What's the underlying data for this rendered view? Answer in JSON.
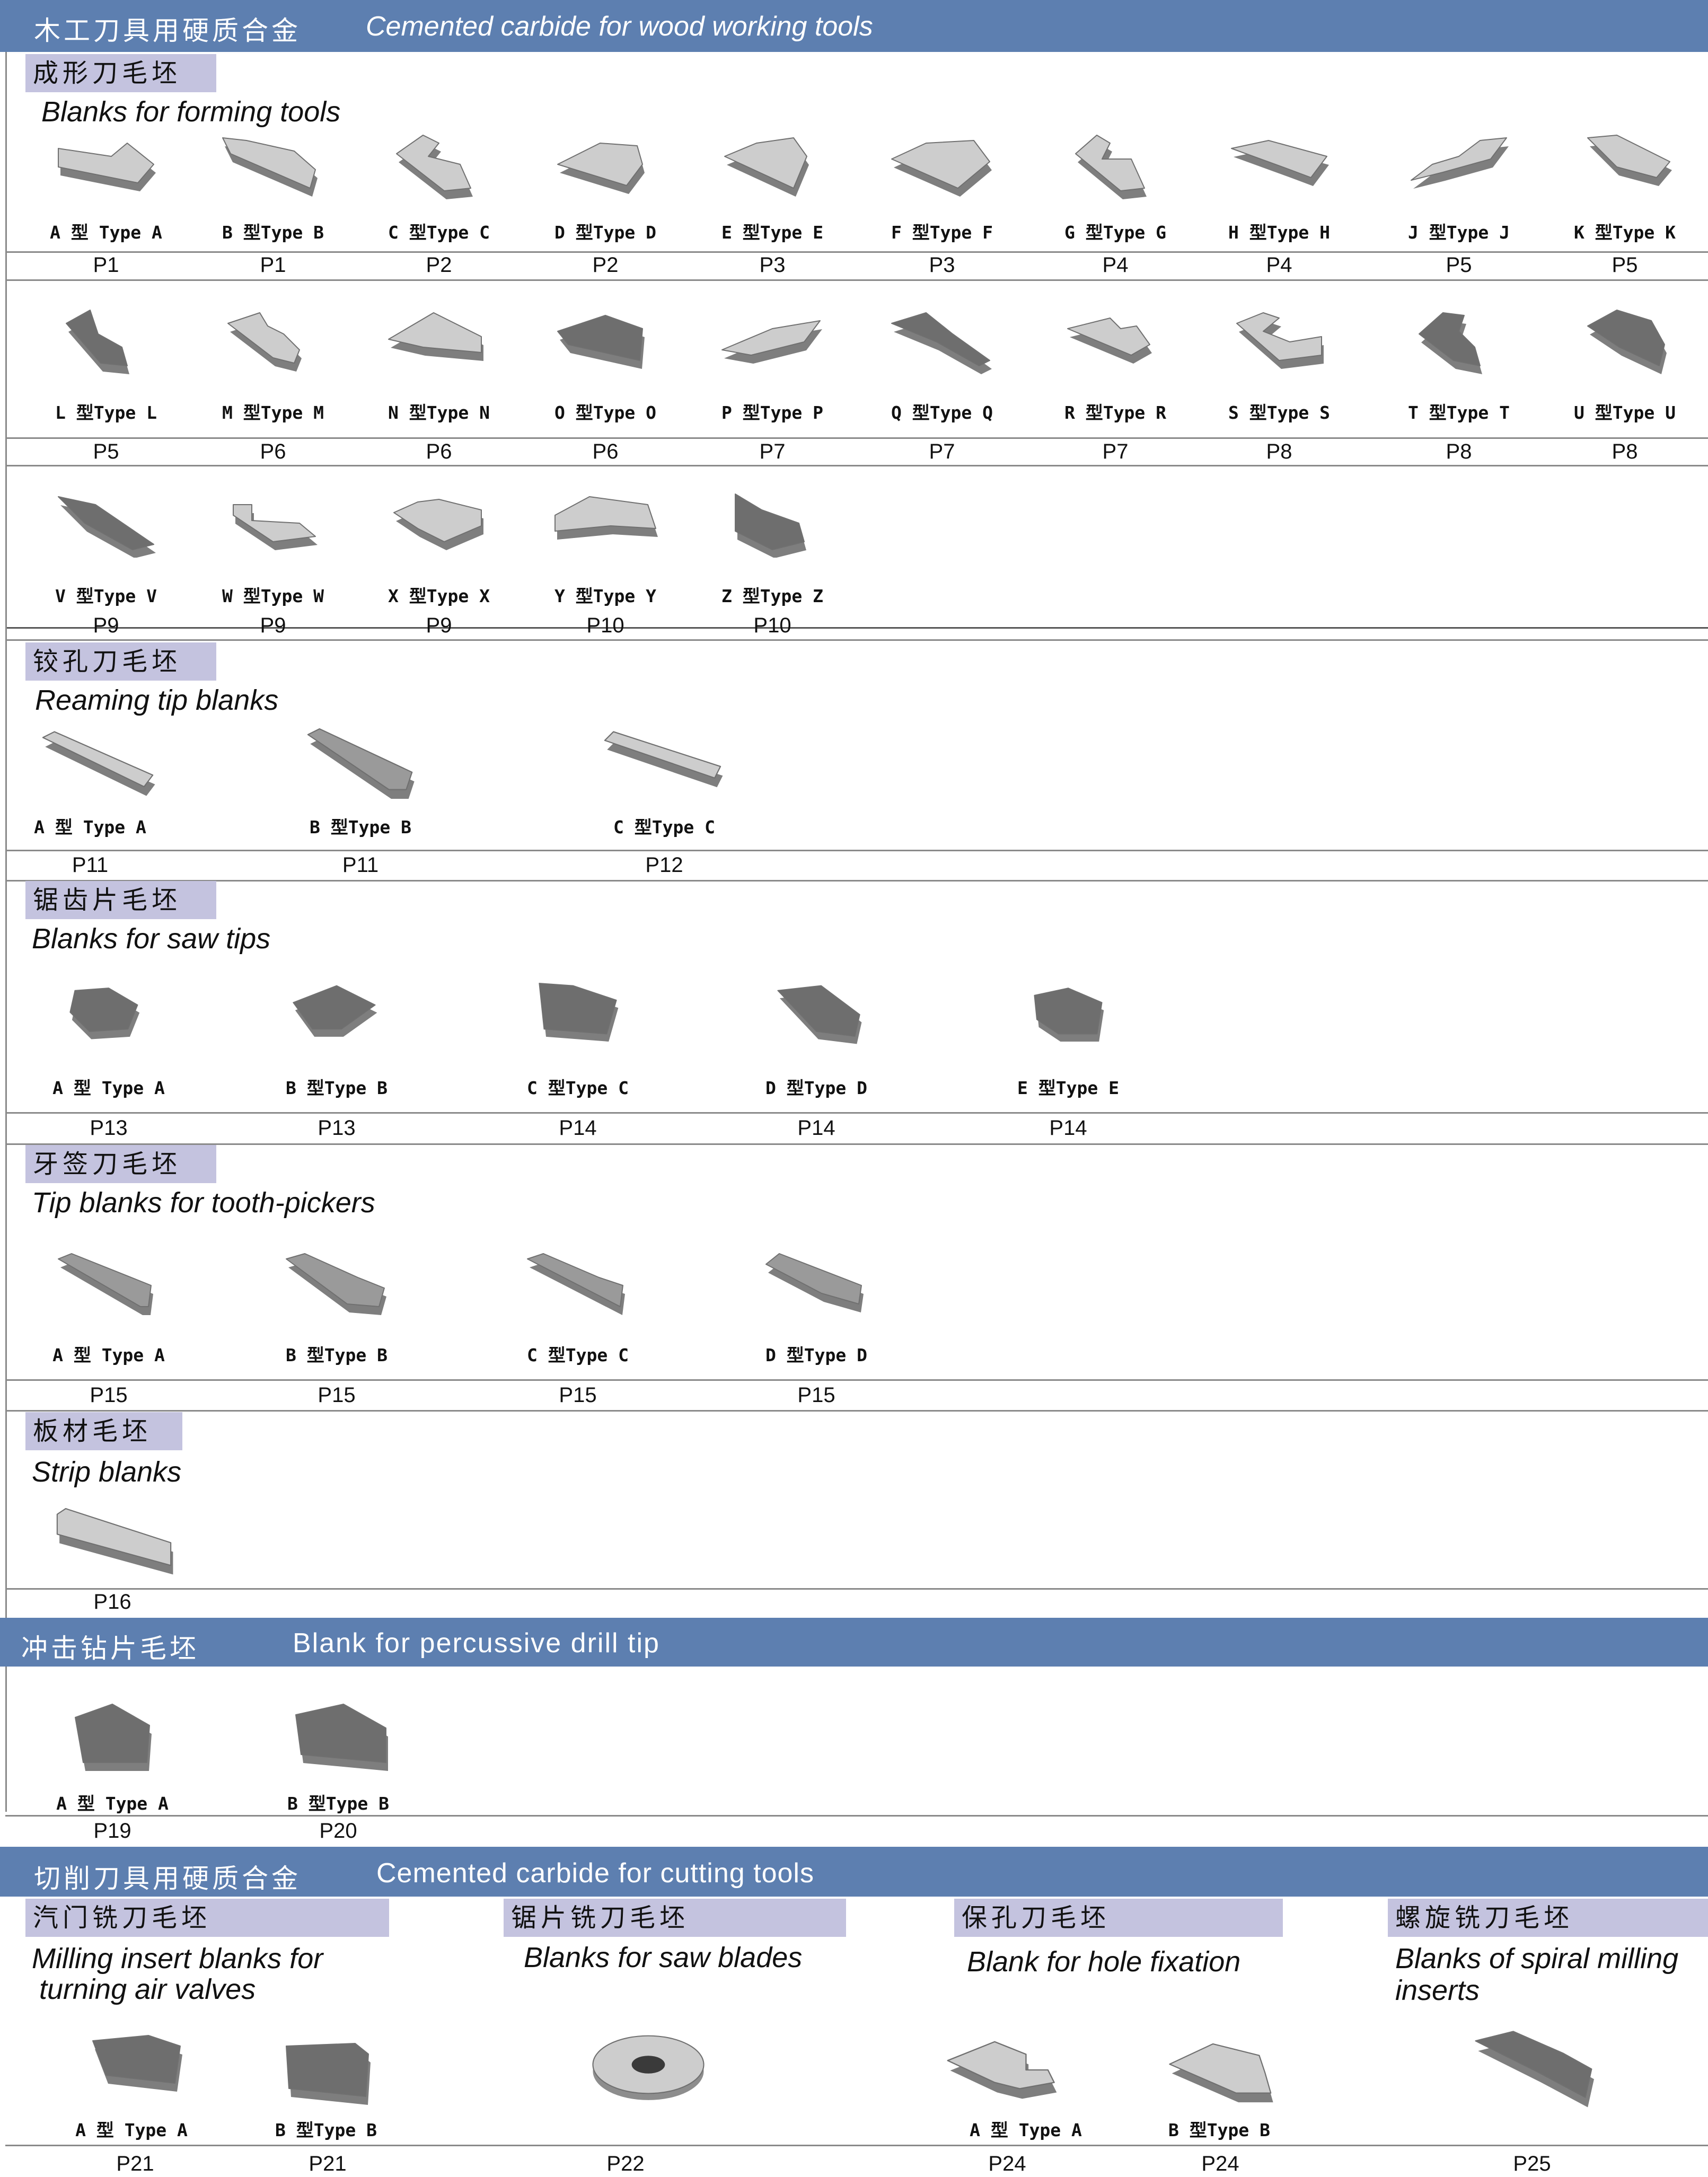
{
  "banner_wood": {
    "cn": "木工刀具用硬质合金",
    "en": "Cemented carbide for wood working tools"
  },
  "forming": {
    "cn": "成形刀毛坯",
    "en": "Blanks  for forming tools",
    "items": [
      {
        "label": "A 型 Type A",
        "page": "P1",
        "shape": "A"
      },
      {
        "label": "B 型Type B",
        "page": "P1",
        "shape": "B"
      },
      {
        "label": "C 型Type C",
        "page": "P2",
        "shape": "C"
      },
      {
        "label": "D 型Type D",
        "page": "P2",
        "shape": "D"
      },
      {
        "label": "E 型Type E",
        "page": "P3",
        "shape": "E"
      },
      {
        "label": "F 型Type F",
        "page": "P3",
        "shape": "F"
      },
      {
        "label": "G 型Type G",
        "page": "P4",
        "shape": "G"
      },
      {
        "label": "H 型Type H",
        "page": "P4",
        "shape": "H"
      },
      {
        "label": "J 型Type J",
        "page": "P5",
        "shape": "J"
      },
      {
        "label": "K 型Type K",
        "page": "P5",
        "shape": "K"
      },
      {
        "label": "L 型Type L",
        "page": "P5",
        "shape": "L"
      },
      {
        "label": "M 型Type M",
        "page": "P6",
        "shape": "M"
      },
      {
        "label": "N 型Type N",
        "page": "P6",
        "shape": "N"
      },
      {
        "label": "O 型Type O",
        "page": "P6",
        "shape": "O"
      },
      {
        "label": "P 型Type P",
        "page": "P7",
        "shape": "P"
      },
      {
        "label": "Q 型Type Q",
        "page": "P7",
        "shape": "Q"
      },
      {
        "label": "R 型Type R",
        "page": "P7",
        "shape": "R"
      },
      {
        "label": "S 型Type S",
        "page": "P8",
        "shape": "S"
      },
      {
        "label": "T 型Type T",
        "page": "P8",
        "shape": "T"
      },
      {
        "label": "U 型Type U",
        "page": "P8",
        "shape": "U"
      },
      {
        "label": "V 型Type V",
        "page": "P9",
        "shape": "V"
      },
      {
        "label": "W 型Type W",
        "page": "P9",
        "shape": "W"
      },
      {
        "label": "X 型Type X",
        "page": "P9",
        "shape": "X"
      },
      {
        "label": "Y 型Type Y",
        "page": "P10",
        "shape": "Y"
      },
      {
        "label": "Z 型Type Z",
        "page": "P10",
        "shape": "Z"
      }
    ]
  },
  "reaming": {
    "cn": "铰孔刀毛坯",
    "en": "Reaming tip blanks",
    "items": [
      {
        "label": "A 型 Type A",
        "page": "P11"
      },
      {
        "label": "B 型Type B",
        "page": "P11"
      },
      {
        "label": "C 型Type C",
        "page": "P12"
      }
    ]
  },
  "saw": {
    "cn": "锯齿片毛坯",
    "en": "Blanks for saw tips",
    "items": [
      {
        "label": "A 型 Type A",
        "page": "P13"
      },
      {
        "label": "B 型Type B",
        "page": "P13"
      },
      {
        "label": "C 型Type C",
        "page": "P14"
      },
      {
        "label": "D 型Type D",
        "page": "P14"
      },
      {
        "label": "E 型Type E",
        "page": "P14"
      }
    ]
  },
  "tooth": {
    "cn": "牙签刀毛坯",
    "en": "Tip blanks for tooth-pickers",
    "items": [
      {
        "label": "A 型 Type A",
        "page": "P15"
      },
      {
        "label": "B 型Type B",
        "page": "P15"
      },
      {
        "label": "C 型Type C",
        "page": "P15"
      },
      {
        "label": "D 型Type D",
        "page": "P15"
      }
    ]
  },
  "strip": {
    "cn": "板材毛坯",
    "en": "Strip blanks",
    "items": [
      {
        "page": "P16"
      }
    ]
  },
  "banner_drill": {
    "cn": "冲击钻片毛坯",
    "en": "Blank for percussive drill tip"
  },
  "drill": {
    "items": [
      {
        "label": "A 型 Type A",
        "page": "P19"
      },
      {
        "label": "B 型Type B",
        "page": "P20"
      }
    ]
  },
  "banner_cutting": {
    "cn": "切削刀具用硬质合金",
    "en": "Cemented carbide for cutting tools"
  },
  "valves": {
    "cn": "汽门铣刀毛坯",
    "en": [
      "Milling insert blanks for",
      "turning air valves"
    ],
    "items": [
      {
        "label": "A 型 Type A",
        "page": "P21"
      },
      {
        "label": "B 型Type B",
        "page": "P21"
      }
    ]
  },
  "sawblades": {
    "cn": "锯片铣刀毛坯",
    "en": "Blanks for saw blades",
    "items": [
      {
        "page": "P22"
      }
    ]
  },
  "hole": {
    "cn": "保孔刀毛坯",
    "en": "Blank for hole fixation",
    "items": [
      {
        "label": "A 型 Type A",
        "page": "P24"
      },
      {
        "label": "B 型Type B",
        "page": "P24"
      }
    ]
  },
  "spiral": {
    "cn": "螺旋铣刀毛坯",
    "en": [
      "Blanks of spiral milling",
      "inserts"
    ],
    "items": [
      {
        "page": "P25"
      }
    ]
  },
  "colors": {
    "banner": "#5d7fb0",
    "tab": "#c4c3df",
    "light": "#cdcdcd",
    "dark": "#6e6e6e"
  }
}
